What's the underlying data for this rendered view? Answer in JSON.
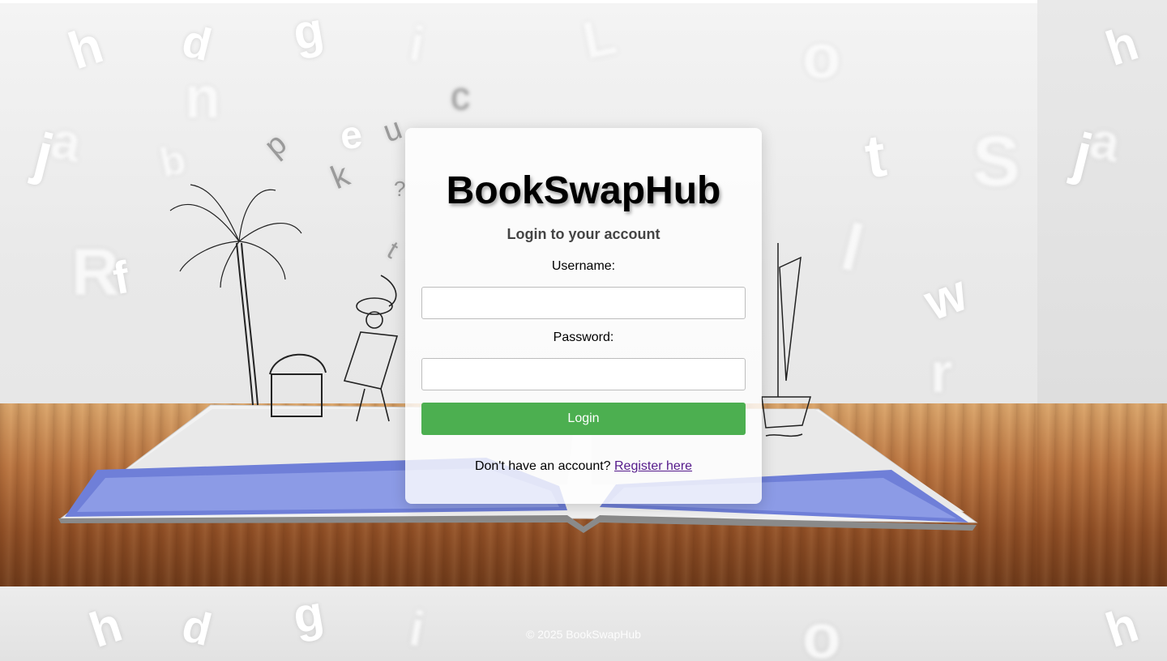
{
  "app": {
    "brand": "BookSwapHub",
    "subtitle": "Login to your account"
  },
  "form": {
    "username_label": "Username:",
    "username_value": "",
    "password_label": "Password:",
    "password_value": "",
    "login_button": "Login"
  },
  "register": {
    "prompt": "Don't have an account?",
    "link_text": "Register here"
  },
  "footer": {
    "text": "© 2025 BookSwapHub"
  },
  "colors": {
    "login_button": "#4caf50",
    "link": "#551a8b"
  },
  "background": {
    "floating_letters": [
      "h",
      "d",
      "g",
      "i",
      "L",
      "o",
      "n",
      "c",
      "k",
      "e",
      "u",
      "p",
      "b",
      "?",
      "t",
      "a",
      "j",
      "R",
      "f",
      "t",
      "S",
      "w",
      "r",
      "l",
      "h",
      "d",
      "g",
      "i",
      "o",
      "h",
      "j",
      "a"
    ]
  }
}
